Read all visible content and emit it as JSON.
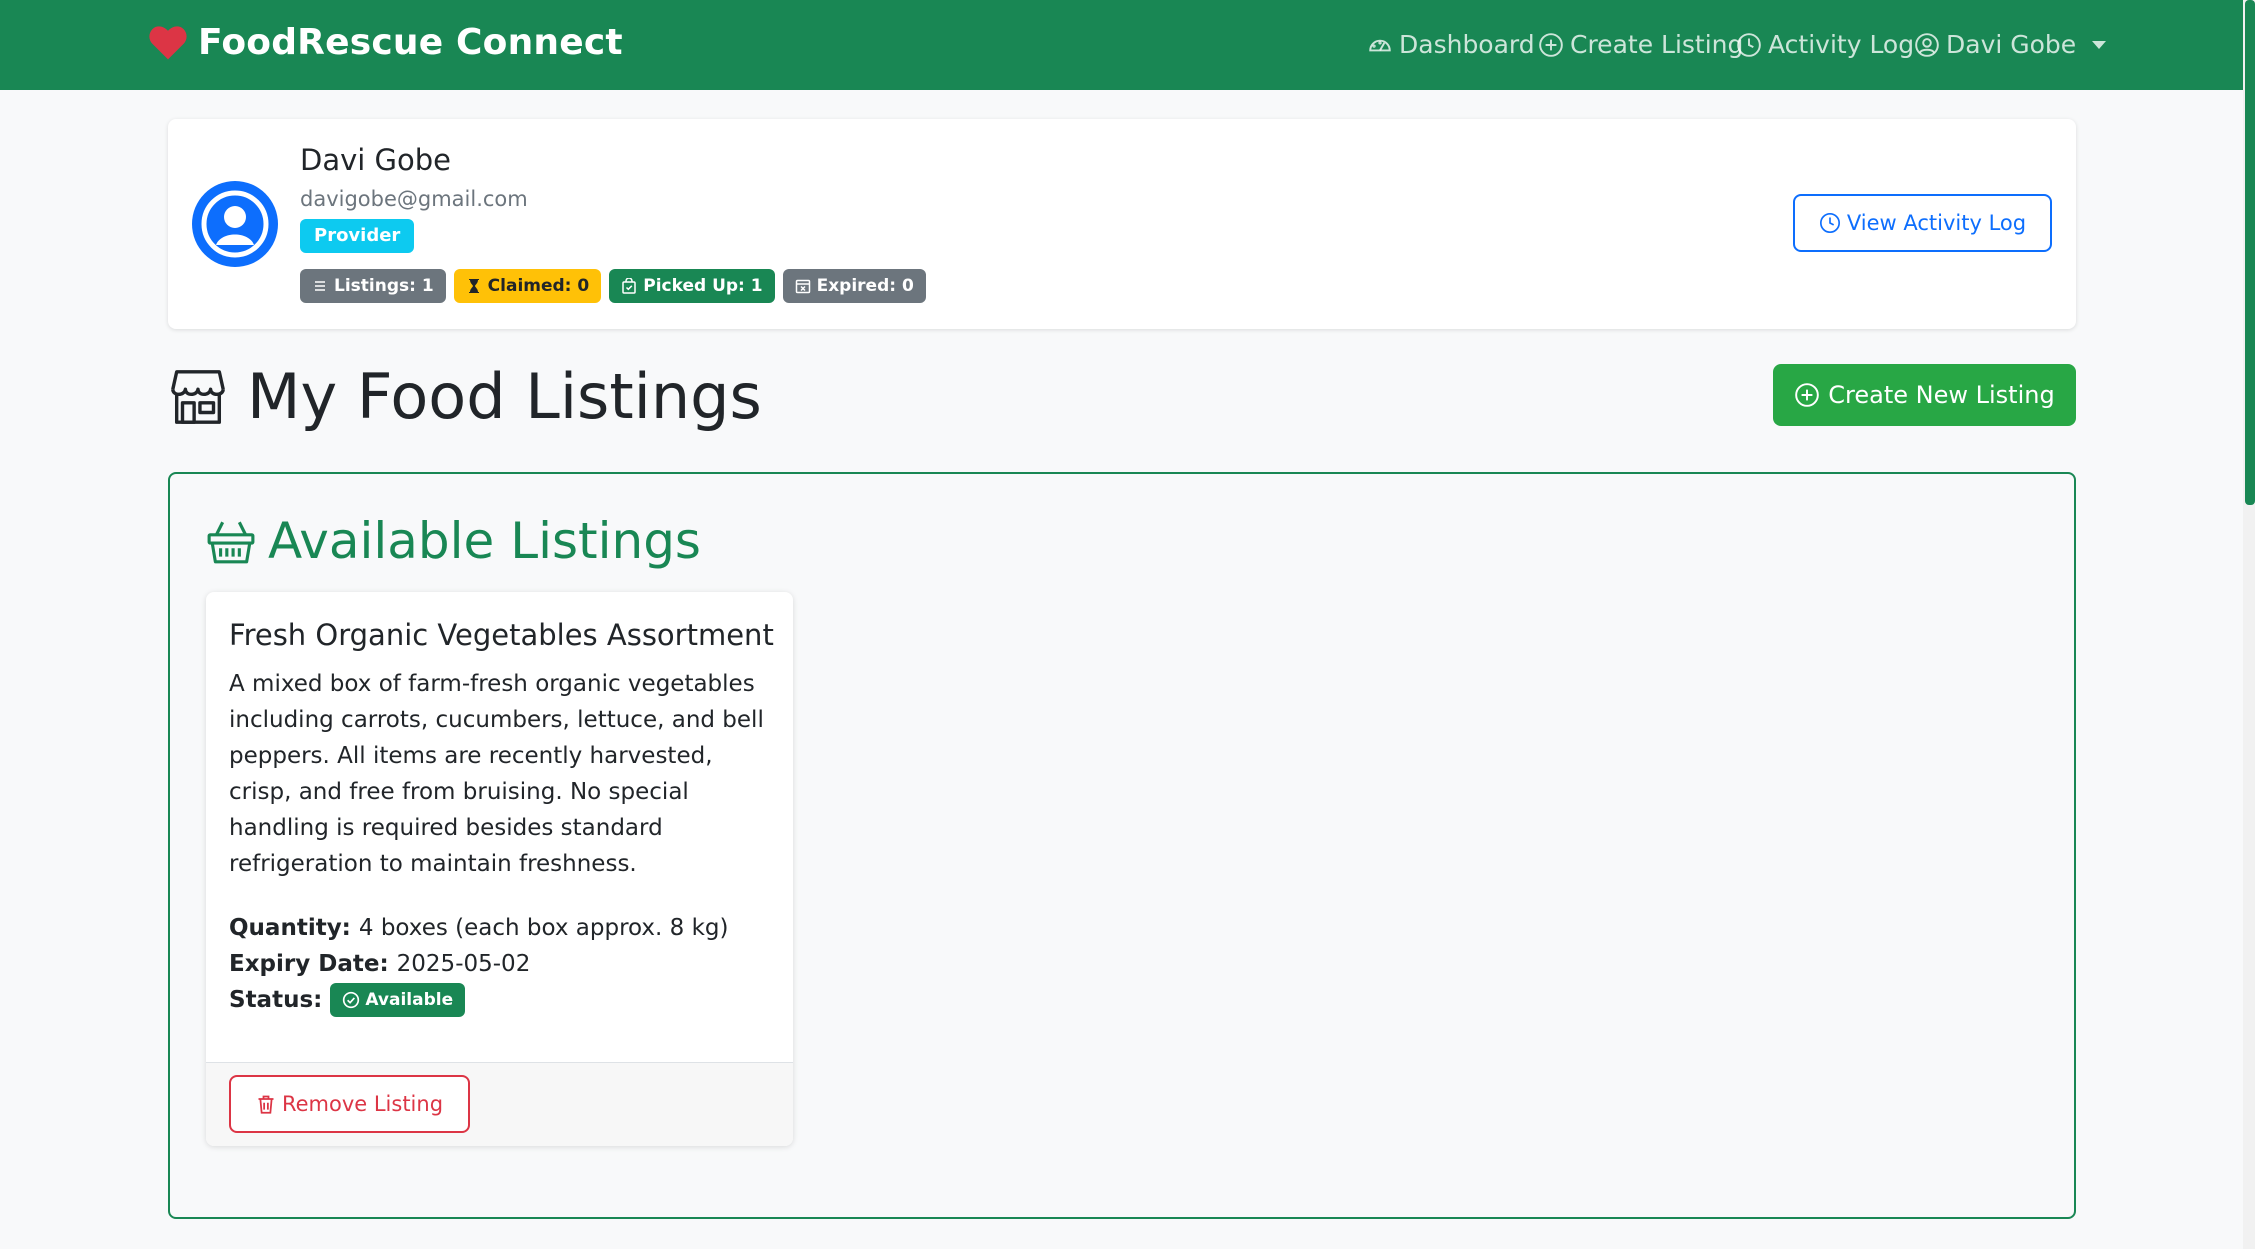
{
  "navbar": {
    "brand": "FoodRescue Connect",
    "links": [
      {
        "label": "Dashboard",
        "icon": "speedometer-icon"
      },
      {
        "label": "Create Listing",
        "icon": "plus-circle-icon"
      },
      {
        "label": "Activity Log",
        "icon": "clock-icon"
      },
      {
        "label": "Davi Gobe",
        "icon": "person-circle-icon"
      }
    ]
  },
  "profile": {
    "name": "Davi Gobe",
    "email": "davigobe@gmail.com",
    "role": "Provider",
    "stats": [
      {
        "label": "Listings: 1",
        "icon": "list-icon"
      },
      {
        "label": "Claimed: 0",
        "icon": "hourglass-icon"
      },
      {
        "label": "Picked Up: 1",
        "icon": "bag-check-icon"
      },
      {
        "label": "Expired: 0",
        "icon": "calendar-x-icon"
      }
    ],
    "view_log_label": "View Activity Log"
  },
  "page": {
    "title": "My Food Listings",
    "create_label": "Create New Listing"
  },
  "available": {
    "heading": "Available Listings",
    "listings": [
      {
        "title": "Fresh Organic Vegetables Assortment",
        "description": "A mixed box of farm-fresh organic vegetables including carrots, cucumbers, lettuce, and bell peppers. All items are recently harvested, crisp, and free from bruising. No special handling is required besides standard refrigeration to maintain freshness.",
        "quantity_label": "Quantity:",
        "quantity": "4 boxes (each box approx. 8 kg)",
        "expiry_label": "Expiry Date:",
        "expiry": "2025-05-02",
        "status_label": "Status:",
        "status": "Available",
        "remove_label": "Remove Listing"
      }
    ]
  },
  "colors": {
    "navbar": "#198754",
    "primary": "#0d6efd",
    "success": "#28a745",
    "danger": "#dc3545",
    "warning": "#ffc107",
    "info": "#0dcaf0",
    "secondary": "#6c757d"
  }
}
